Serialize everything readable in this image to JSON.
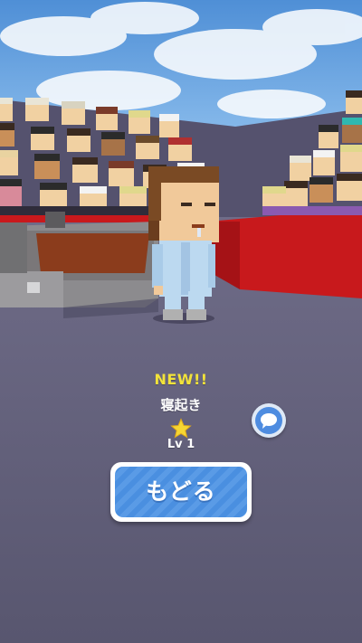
{
  "result": {
    "new_label": "NEW!!",
    "character_name": "寝起き",
    "level": "Lv 1"
  },
  "buttons": {
    "back_label": "もどる"
  },
  "icons": {
    "star": "star-icon",
    "chat": "chat-bubble-icon"
  },
  "colors": {
    "new_label": "#f2e33a",
    "button_blue": "#4a8fe0",
    "wall_red": "#c8191c",
    "floor": "#5e5b77"
  }
}
